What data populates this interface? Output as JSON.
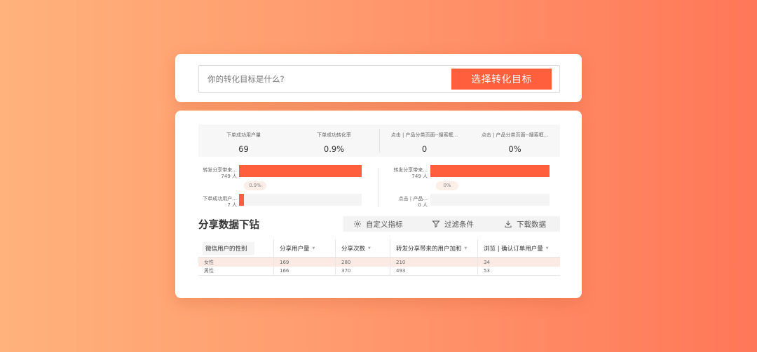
{
  "search": {
    "placeholder": "你的转化目标是什么?",
    "button_label": "选择转化目标"
  },
  "metrics": [
    {
      "label": "下单成功用户量",
      "value": "69"
    },
    {
      "label": "下单成功转化率",
      "value": "0.9%"
    },
    {
      "label": "点击 | 产品分类页面--搜索框...",
      "value": "0"
    },
    {
      "label": "点击 | 产品分类页面--搜索框...",
      "value": "0%"
    }
  ],
  "funnels": [
    {
      "top": {
        "label": "转发分享带来...",
        "count": "749 人",
        "fill": 1.0
      },
      "conversion": "0.9%",
      "bottom": {
        "label": "下单成功用户...",
        "count": "7 人",
        "fill": 0.04
      }
    },
    {
      "top": {
        "label": "转发分享带来...",
        "count": "749 人",
        "fill": 1.0
      },
      "conversion": "0%",
      "bottom": {
        "label": "点击 | 产品...",
        "count": "0 人",
        "fill": 0.0
      }
    }
  ],
  "section": {
    "title": "分享数据下钻"
  },
  "toolbar": {
    "custom_metric": "自定义指标",
    "filter": "过滤条件",
    "download": "下载数据"
  },
  "table": {
    "columns": [
      "微信用户的性别",
      "分享用户量",
      "分享次数",
      "转发分享带来的用户加和",
      "浏览 | 确认订单用户量"
    ],
    "rows": [
      [
        "女性",
        "169",
        "280",
        "210",
        "34"
      ],
      [
        "男性",
        "166",
        "370",
        "493",
        "53"
      ]
    ]
  },
  "colors": {
    "accent": "#ff5f3c",
    "highlight_row": "#fbe9e4"
  }
}
